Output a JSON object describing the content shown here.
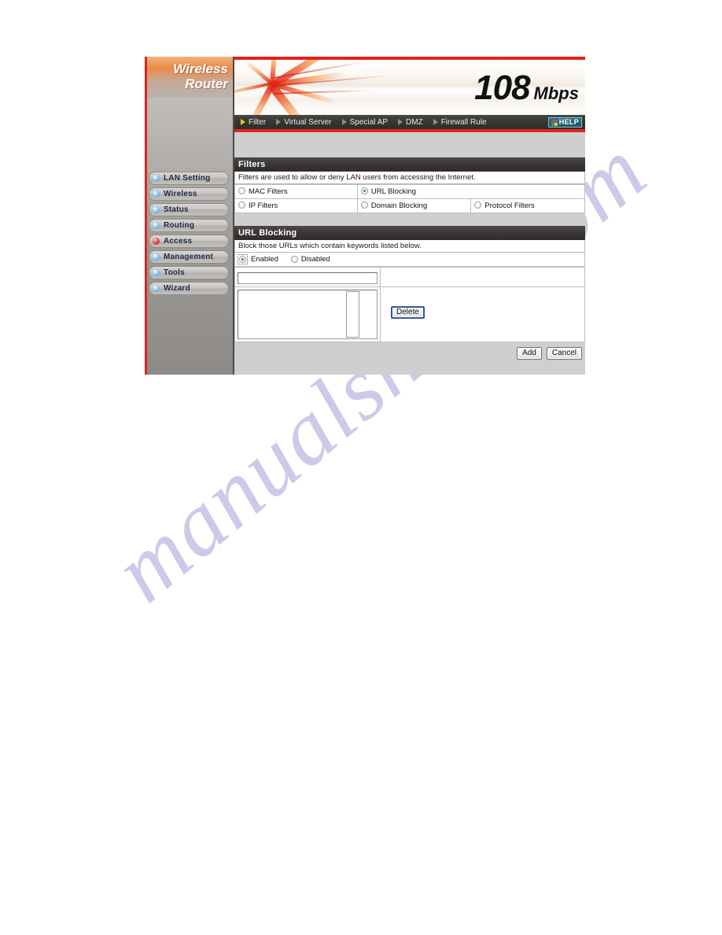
{
  "watermark": {
    "text": "manualshive.com"
  },
  "brand": {
    "logo_line1": "Wireless",
    "logo_line2": "Router",
    "speed_number": "108",
    "speed_unit": "Mbps",
    "accent_red": "#e2231a",
    "accent_orange": "#e98c4a"
  },
  "sidebar": {
    "items": [
      {
        "label": "LAN Setting",
        "active": false
      },
      {
        "label": "Wireless",
        "active": false
      },
      {
        "label": "Status",
        "active": false
      },
      {
        "label": "Routing",
        "active": false
      },
      {
        "label": "Access",
        "active": true
      },
      {
        "label": "Management",
        "active": false
      },
      {
        "label": "Tools",
        "active": false
      },
      {
        "label": "Wizard",
        "active": false
      }
    ]
  },
  "navbar": {
    "items": [
      {
        "label": "Filter",
        "active": true
      },
      {
        "label": "Virtual Server",
        "active": false
      },
      {
        "label": "Special AP",
        "active": false
      },
      {
        "label": "DMZ",
        "active": false
      },
      {
        "label": "Firewall Rule",
        "active": false
      }
    ],
    "help_label": "HELP",
    "help_icon": "help-color-squares-icon"
  },
  "filters_section": {
    "title": "Filters",
    "description": "Filters are used to allow or deny LAN users from accessing the Internet.",
    "options": [
      {
        "label": "MAC Filters",
        "checked": false
      },
      {
        "label": "URL Blocking",
        "checked": true
      },
      {
        "label": "IP Filters",
        "checked": false
      },
      {
        "label": "Domain Blocking",
        "checked": false
      },
      {
        "label": "Protocol Filters",
        "checked": false
      }
    ]
  },
  "url_blocking_section": {
    "title": "URL Blocking",
    "description": "Block those URLs which contain keywords listed below.",
    "enabled_label": "Enabled",
    "disabled_label": "Disabled",
    "enabled_checked": true,
    "disabled_checked": false,
    "keyword_value": "",
    "keyword_placeholder": "",
    "list_items": [],
    "delete_label": "Delete"
  },
  "footer": {
    "add_label": "Add",
    "cancel_label": "Cancel"
  }
}
